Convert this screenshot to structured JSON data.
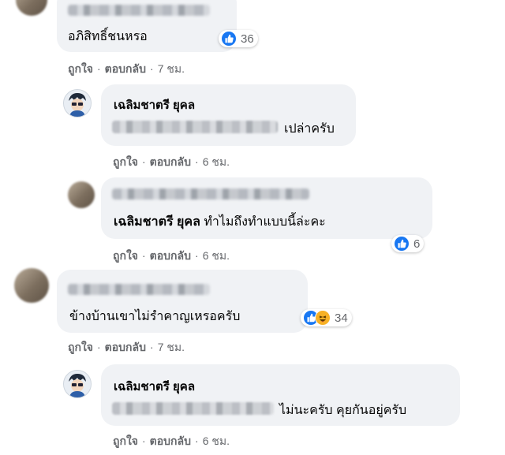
{
  "comments": [
    {
      "text": "อภิสิทธิ์ชนหรอ",
      "reaction_count": "36",
      "actions": {
        "like": "ถูกใจ",
        "reply": "ตอบกลับ",
        "time": "7 ชม."
      }
    },
    {
      "author": "เฉลิมชาตรี ยุคล",
      "text": "เปล่าครับ",
      "actions": {
        "like": "ถูกใจ",
        "reply": "ตอบกลับ",
        "time": "6 ชม."
      }
    },
    {
      "mention": "เฉลิมชาตรี ยุคล",
      "text": "ทำไมถึงทำแบบนี้ล่ะคะ",
      "reaction_count": "6",
      "actions": {
        "like": "ถูกใจ",
        "reply": "ตอบกลับ",
        "time": "6 ชม."
      }
    },
    {
      "text": "ข้างบ้านเขาไม่รำคาญเหรอครับ",
      "reaction_count": "34",
      "actions": {
        "like": "ถูกใจ",
        "reply": "ตอบกลับ",
        "time": "7 ชม."
      }
    },
    {
      "author": "เฉลิมชาตรี ยุคล",
      "text": "ไม่นะครับ คุยกันอยู่ครับ",
      "actions": {
        "like": "ถูกใจ",
        "reply": "ตอบกลับ",
        "time": "6 ชม."
      }
    }
  ],
  "separator": "·",
  "icons": {
    "like": "like-thumb-icon",
    "haha": "haha-face-icon"
  },
  "colors": {
    "like_blue": "#1877f2",
    "haha_yellow": "#f7b125",
    "bubble": "#f0f2f5",
    "meta": "#65676b"
  }
}
